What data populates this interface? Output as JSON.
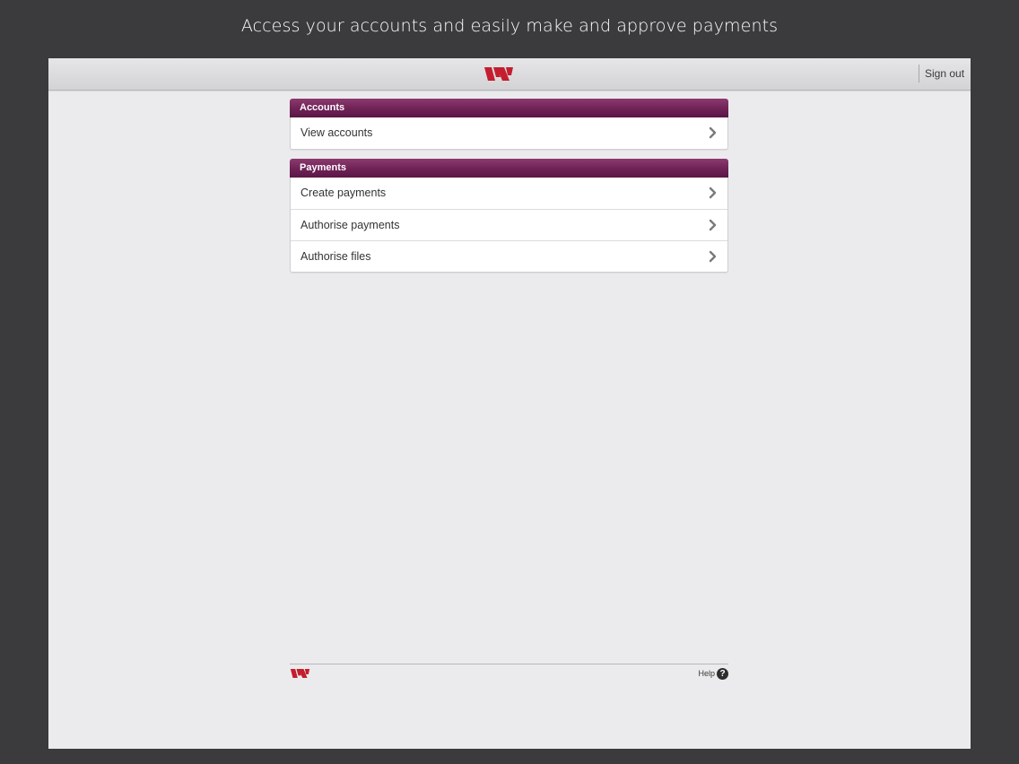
{
  "caption": "Access your accounts and easily make and approve payments",
  "header": {
    "sign_out_label": "Sign out",
    "logo_icon": "westpac-w-logo"
  },
  "sections": [
    {
      "title": "Accounts",
      "items": [
        {
          "label": "View accounts"
        }
      ]
    },
    {
      "title": "Payments",
      "items": [
        {
          "label": "Create payments"
        },
        {
          "label": "Authorise payments"
        },
        {
          "label": "Authorise files"
        }
      ]
    }
  ],
  "footer": {
    "help_label": "Help",
    "help_icon_glyph": "?"
  },
  "colors": {
    "brand_red": "#c41e2e",
    "section_header": "#6e2256",
    "outer_background": "#3b3a3c",
    "screen_background": "#ebebed"
  }
}
